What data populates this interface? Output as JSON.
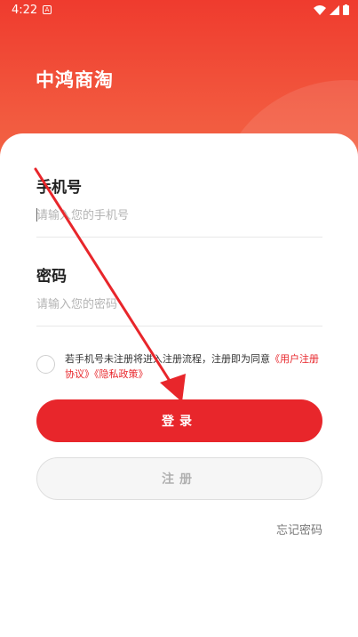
{
  "status_bar": {
    "time": "4:22",
    "notification_letter": "A"
  },
  "app": {
    "title": "中鸿商淘"
  },
  "phone_field": {
    "label": "手机号",
    "placeholder": "请输入您的手机号",
    "value": ""
  },
  "password_field": {
    "label": "密码",
    "placeholder": "请输入您的密码",
    "value": ""
  },
  "agreement": {
    "text": "若手机号未注册将进入注册流程，注册即为同意",
    "user_agreement_link": "《用户注册协议》",
    "privacy_link": "《隐私政策》",
    "checked": false
  },
  "buttons": {
    "login": "登录",
    "register": "注册"
  },
  "forgot_password": "忘记密码",
  "colors": {
    "accent": "#e8262b",
    "header": "#ef3b2e",
    "annotation_arrow": "#e8262b"
  }
}
